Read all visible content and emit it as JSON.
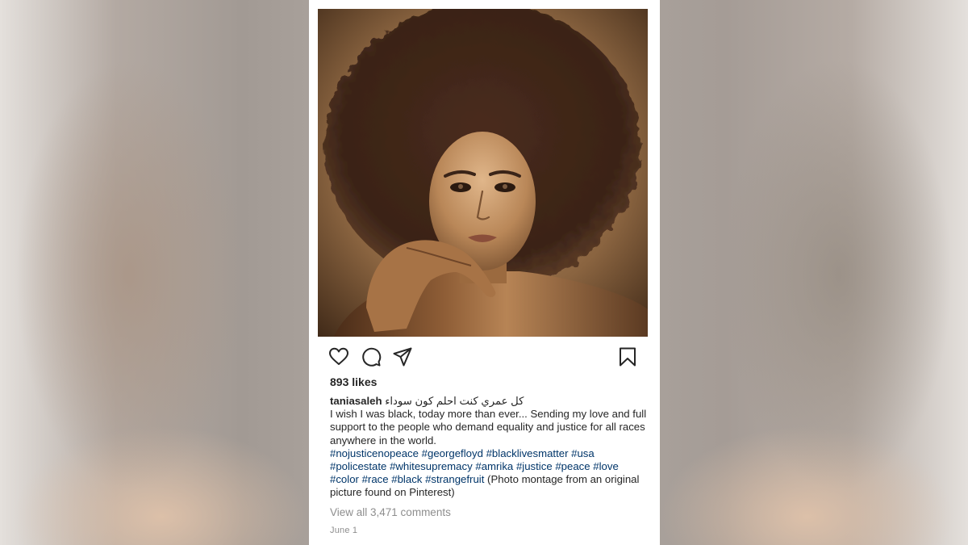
{
  "post": {
    "likes": "893 likes",
    "username": "taniasaleh",
    "arabic_caption": "كل عمري كنت احلم كون سوداء",
    "caption_text": "I wish I was black, today more than ever... Sending my love and full support to the people who demand equality and justice for all races anywhere in the world.",
    "hashtags": [
      "#nojusticenopeace",
      "#georgefloyd",
      "#blacklivesmatter",
      "#usa",
      "#policestate",
      "#whitesupremacy",
      "#amrika",
      "#justice",
      "#peace",
      "#love",
      "#color",
      "#race",
      "#black",
      "#strangefruit"
    ],
    "caption_suffix": "(Photo montage from an original picture found on Pinterest)",
    "view_comments": "View all 3,471 comments",
    "date": "June 1"
  },
  "icons": {
    "like": "heart-icon",
    "comment": "comment-icon",
    "share": "share-icon",
    "save": "bookmark-icon"
  },
  "colors": {
    "hashtag": "#003569",
    "text": "#262626",
    "muted": "#8e8e8e"
  }
}
